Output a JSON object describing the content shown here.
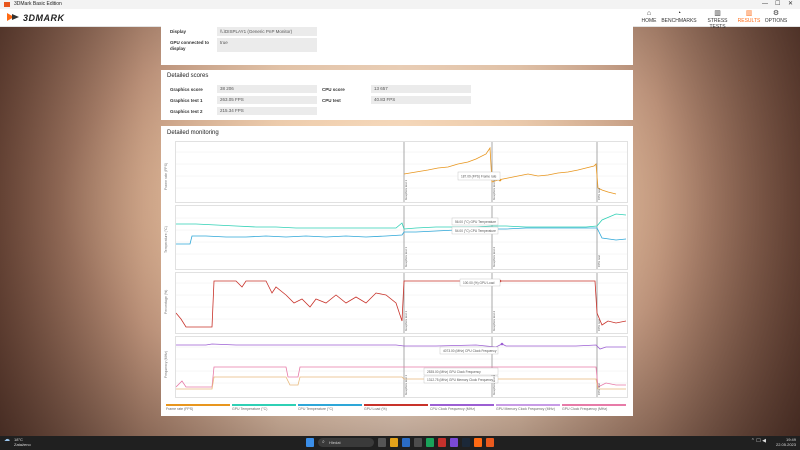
{
  "window": {
    "title": "3DMark Basic Edition",
    "min": "—",
    "max": "☐",
    "close": "✕"
  },
  "app": {
    "brand": "3DMARK"
  },
  "nav": [
    {
      "label": "HOME",
      "icon": "home-icon",
      "glyph": "⌂"
    },
    {
      "label": "BENCHMARKS",
      "icon": "benchmarks-icon",
      "glyph": "◔"
    },
    {
      "label": "STRESS TESTS",
      "icon": "stress-tests-icon",
      "glyph": "▥"
    },
    {
      "label": "RESULTS",
      "icon": "results-icon",
      "glyph": "▥",
      "active": true
    },
    {
      "label": "OPTIONS",
      "icon": "options-icon",
      "glyph": "⚙"
    }
  ],
  "display_info": {
    "display_label": "Display",
    "display_value": "\\\\.\\DISPLAY1 (Generic PnP Monitor)",
    "gpu_connected_label_1": "GPU connected to",
    "gpu_connected_label_2": "display",
    "gpu_connected_value": "true"
  },
  "detailed_scores": {
    "title": "Detailed scores",
    "rows": [
      {
        "label": "Graphics score",
        "value": "38 206"
      },
      {
        "label": "Graphics test 1",
        "value": "263.05 FPS"
      },
      {
        "label": "Graphics test 2",
        "value": "215.34 FPS"
      },
      {
        "label": "CPU score",
        "value": "13 657"
      },
      {
        "label": "CPU test",
        "value": "40.83 FPS"
      }
    ]
  },
  "monitoring": {
    "title": "Detailed monitoring",
    "y_labels": [
      "Frame rate (FPS)",
      "Temperature (°C)",
      "Percentage (%)",
      "Frequency (MHz)"
    ],
    "markers": [
      "Graphics test 1",
      "Graphics test 2",
      "CPU test"
    ],
    "tooltips": {
      "fps": "187.09 (FPS) Frame rate",
      "gpu_temp": "56.00 (°C) GPU Temperature",
      "cpu_temp": "54.00 (°C) CPU Temperature",
      "gpu_load": "100.00 (%) GPU Load",
      "cpu_clock": "4073.00 (MHz) CPU Clock Frequency",
      "gpu_clock": "2535.00 (MHz) GPU Clock Frequency",
      "gpu_mem": "1312.75 (MHz) GPU Memory Clock Frequency"
    },
    "legend": [
      {
        "label": "Frame rate (FPS)",
        "color": "#e8961e"
      },
      {
        "label": "GPU Temperature (°C)",
        "color": "#2fd0b5"
      },
      {
        "label": "CPU Temperature (°C)",
        "color": "#2ea7d8"
      },
      {
        "label": "GPU Load (%)",
        "color": "#c8322a"
      },
      {
        "label": "CPU Clock Frequency (MHz)",
        "color": "#9c5fd3"
      },
      {
        "label": "GPU Memory Clock Frequency (MHz)",
        "color": "#c89be6"
      },
      {
        "label": "GPU Clock Frequency (MHz)",
        "color": "#e77ba8"
      }
    ]
  },
  "taskbar": {
    "weather_temp": "18°C",
    "weather_desc": "Zataženo",
    "search_placeholder": "Hledat",
    "time": "19:49",
    "date": "22.05.2023"
  }
}
